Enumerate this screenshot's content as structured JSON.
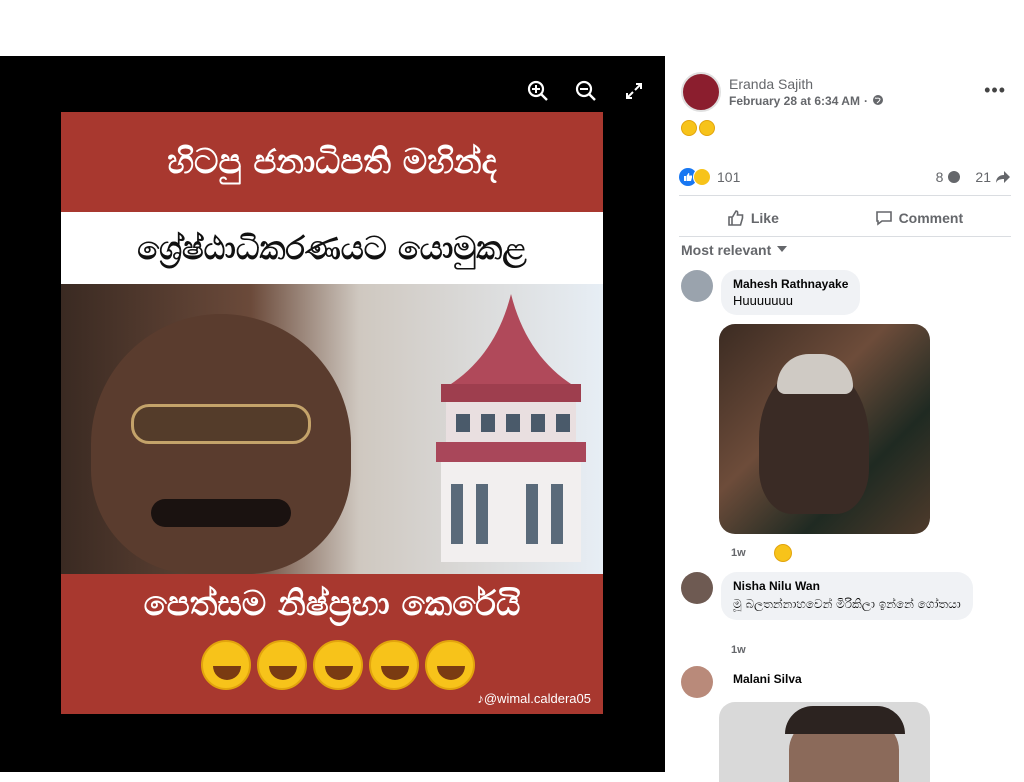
{
  "viewer": {
    "controls": [
      "zoom-in",
      "zoom-out",
      "fullscreen"
    ],
    "image": {
      "line1": "හිටපු ජනාධිපති මහින්ද",
      "line2": "ශ්‍රේෂ්ඨාධිකරණයට යොමුකළ",
      "line3": "පෙත්සම නිෂ්ප්‍රභා කෙරේයි",
      "watermark": "♪@wimal.caldera05"
    }
  },
  "post": {
    "author": "Eranda Sajith",
    "date": "February 28 at 6:34 AM",
    "date_separator": "·",
    "more": "•••",
    "reactions_count": "101",
    "comments_count": "8",
    "shares_count": "21",
    "like_label": "Like",
    "comment_label": "Comment",
    "sort_label": "Most relevant"
  },
  "comments": [
    {
      "name": "Mahesh Rathnayake",
      "text": "Huuuuuuu",
      "time": "1w"
    },
    {
      "name": "Nisha Nilu Wan",
      "text": "මූ බලතන්නාහවෙන් මිරිකිලා ඉන්නේ ගෝතයා",
      "time": "1w"
    },
    {
      "name": "Malani Silva",
      "text": ""
    }
  ],
  "colors": {
    "red": "#a8382f",
    "blue": "#1877f2",
    "gray_text": "#65676b",
    "bubble": "#f0f2f5"
  }
}
